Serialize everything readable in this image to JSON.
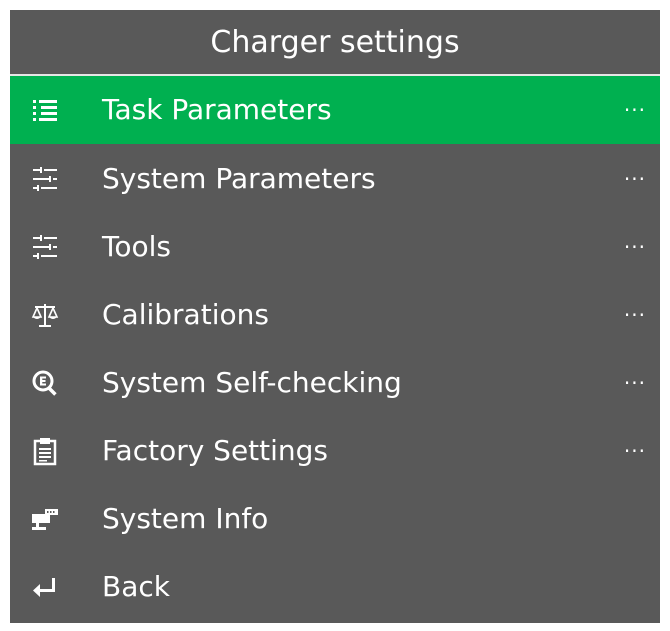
{
  "header": {
    "title": "Charger settings"
  },
  "menu": {
    "more_glyph": "···",
    "items": [
      {
        "label": "Task Parameters",
        "icon": "list-icon",
        "has_more": true,
        "active": true
      },
      {
        "label": "System Parameters",
        "icon": "sliders-icon",
        "has_more": true,
        "active": false
      },
      {
        "label": "Tools",
        "icon": "sliders-icon",
        "has_more": true,
        "active": false
      },
      {
        "label": "Calibrations",
        "icon": "balance-scale-icon",
        "has_more": true,
        "active": false
      },
      {
        "label": "System Self-checking",
        "icon": "magnifier-e-icon",
        "has_more": true,
        "active": false
      },
      {
        "label": "Factory Settings",
        "icon": "clipboard-icon",
        "has_more": true,
        "active": false
      },
      {
        "label": "System Info",
        "icon": "network-pc-icon",
        "has_more": false,
        "active": false
      },
      {
        "label": "Back",
        "icon": "return-arrow-icon",
        "has_more": false,
        "active": false
      }
    ]
  },
  "colors": {
    "background": "#595959",
    "active": "#00b050",
    "text": "#ffffff"
  }
}
